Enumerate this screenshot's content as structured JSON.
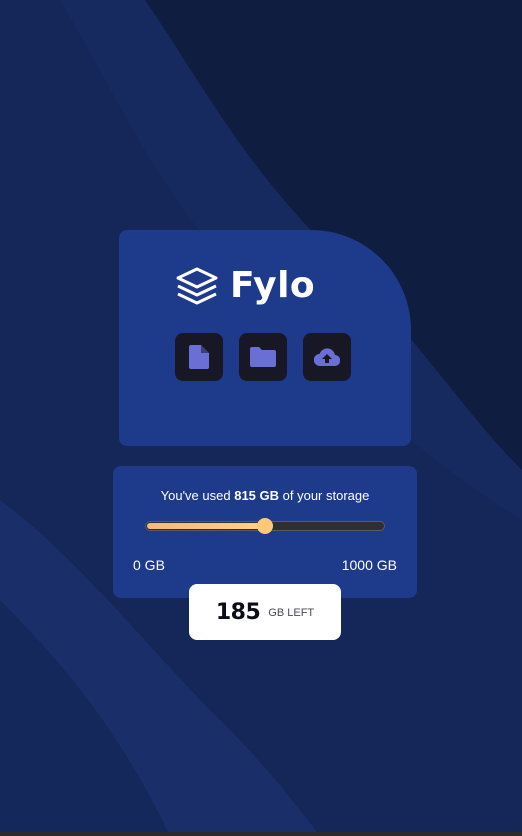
{
  "brand": {
    "name": "Fylo",
    "logo_icon": "stacked-layers-icon"
  },
  "toolbar": {
    "buttons": [
      {
        "icon": "document-icon"
      },
      {
        "icon": "folder-icon"
      },
      {
        "icon": "cloud-upload-icon"
      }
    ]
  },
  "storage": {
    "used_prefix": "You've used ",
    "used_amount": "815 GB",
    "used_suffix": " of your storage",
    "min_label": "0 GB",
    "max_label": "1000 GB",
    "used_fraction": 0.5
  },
  "remaining": {
    "value": "185",
    "unit": "GB LEFT"
  },
  "colors": {
    "background": "#0f1d40",
    "card": "#1e3a8a",
    "icon_tile": "#181726",
    "icon_fill": "#6a6fd6",
    "slider_fill": "#ffc978",
    "text": "#ffffff"
  }
}
